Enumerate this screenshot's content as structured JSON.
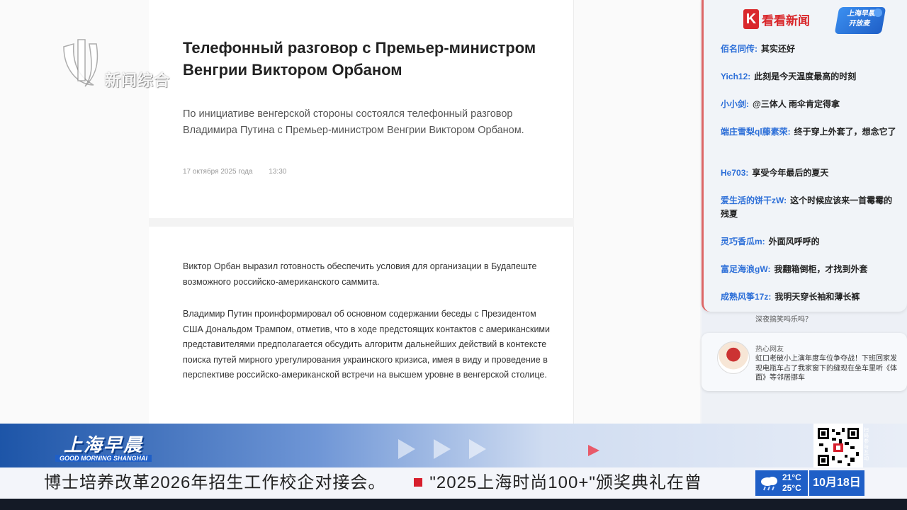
{
  "article": {
    "title": "Телефонный разговор с Премьер-министром Венгрии Виктором Орбаном",
    "lead": "По инициативе венгерской стороны состоялся телефонный разговор Владимира Путина с Премьер-министром Венгрии Виктором Орбаном.",
    "date": "17 октября 2025 года",
    "time": "13:30",
    "paragraphs": [
      "Виктор Орбан выразил готовность обеспечить условия для организации в Будапеште возможного российско-американского саммита.",
      "Владимир Путин проинформировал об основном содержании беседы с Президентом США Дональдом Трампом, отметив, что в ходе предстоящих контактов с американскими представителями предполагается обсудить алгоритм дальнейших действий в контексте поиска путей мирного урегулирования украинского кризиса, имея в виду и проведение в перспективе российско-американской встречи на высшем уровне в венгерской столице."
    ]
  },
  "channel": {
    "watermark_text": "新闻综合"
  },
  "comment_panel": {
    "logo_text": "看看新闻",
    "show_badge": "上海早晨\n开放麦",
    "comments": [
      {
        "user": "佰名同传:",
        "text": "其实还好"
      },
      {
        "user": "Yich12:",
        "text": "此刻是今天温度最高的时刻"
      },
      {
        "user": "小小剑:",
        "text": "@三体人 雨伞肯定得拿"
      },
      {
        "user": "端庄雪梨ql藤素荣:",
        "text": "终于穿上外套了，想念它了"
      },
      {
        "user": "He703:",
        "text": "享受今年最后的夏天"
      },
      {
        "user": "爱生活的饼干zW:",
        "text": "这个时候应该来一首霉霉的残夏"
      },
      {
        "user": "灵巧香瓜m:",
        "text": "外面风呼呼的"
      },
      {
        "user": "富足海浪gW:",
        "text": "我翻箱倒柜，才找到外套"
      },
      {
        "user": "成熟风筝17z:",
        "text": "我明天穿长袖和薄长裤"
      }
    ],
    "hidden_comment": "深夜搞笑吗乐吗？",
    "pinned": {
      "user": "热心网友",
      "text": "虹口老破小上演年度车位争夺战！下班回家发现电瓶车占了我家窗下的缝现在坐车里听《体面》等邻居挪车"
    }
  },
  "bottom_bar": {
    "show_logo_cn": "上海早晨",
    "show_logo_en": "GOOD MORNING SHANGHAI",
    "qr_side_text": "扫码参与互动",
    "ticker_left": "博士培养改革2026年招生工作校企对接会。",
    "ticker_right": "\"2025上海时尚100+\"颁奖典礼在曾",
    "weather_high": "21°C",
    "weather_low": "25°C",
    "date": "10月18日"
  }
}
